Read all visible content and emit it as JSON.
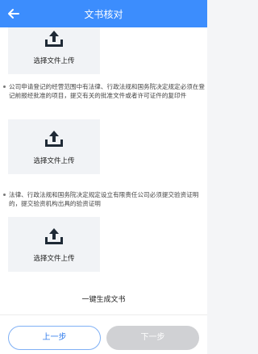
{
  "header": {
    "title": "文书核对",
    "back_icon": "arrow-left-icon",
    "bg_color": "#3c8dfd"
  },
  "uploads": [
    {
      "label": "选择文件上传",
      "icon": "upload-tray-icon"
    },
    {
      "label": "选择文件上传",
      "icon": "upload-tray-icon"
    },
    {
      "label": "选择文件上传",
      "icon": "upload-tray-icon"
    }
  ],
  "requirements": [
    {
      "text": "公司申请登记的经营范围中有法律、行政法规和国务院决定规定必须在登记前报经批准的项目，提交有关的批准文件或者许可证件的复印件"
    },
    {
      "text": "法律、行政法规和国务院决定规定设立有限责任公司必须提交验资证明的，提交验资机构出具的验资证明"
    }
  ],
  "generate": {
    "label": "一键生成文书"
  },
  "footer": {
    "prev_label": "上一步",
    "next_label": "下一步"
  },
  "colors": {
    "accent": "#3c8dfd",
    "disabled": "#d0d1d4"
  }
}
